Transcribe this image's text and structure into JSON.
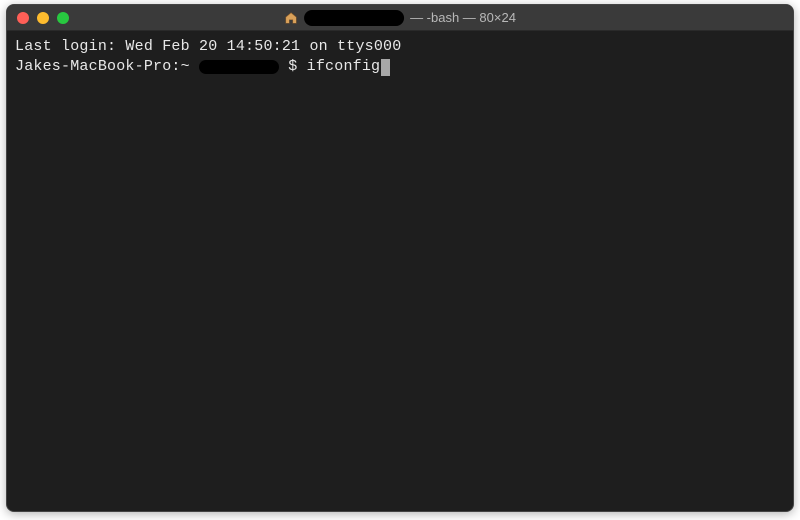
{
  "titlebar": {
    "title_suffix": "— -bash — 80×24"
  },
  "terminal": {
    "last_login_line": "Last login: Wed Feb 20 14:50:21 on ttys000",
    "prompt_host": "Jakes-MacBook-Pro:~",
    "prompt_symbol": "$",
    "typed_command": "ifconfig"
  }
}
